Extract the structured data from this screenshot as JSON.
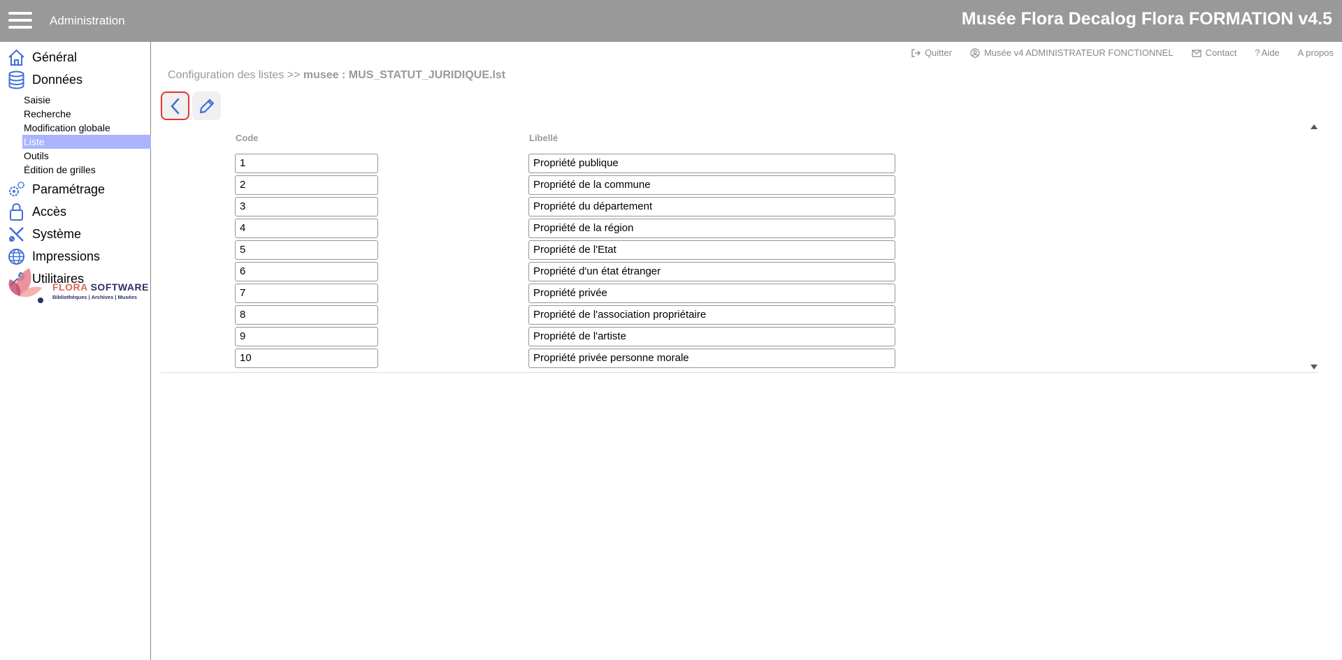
{
  "header": {
    "menu_icon": "hamburger-icon",
    "section": "Administration",
    "title": "Musée Flora Decalog Flora FORMATION v4.5"
  },
  "sidebar": {
    "items": [
      {
        "label": "Général",
        "icon": "home-icon"
      },
      {
        "label": "Données",
        "icon": "database-icon"
      },
      {
        "label": "Paramétrage",
        "icon": "gears-icon"
      },
      {
        "label": "Accès",
        "icon": "lock-icon"
      },
      {
        "label": "Système",
        "icon": "tools-icon"
      },
      {
        "label": "Impressions",
        "icon": "globe-icon"
      },
      {
        "label": "Utilitaires",
        "icon": "wrench-icon"
      }
    ],
    "sub_items": [
      "Saisie",
      "Recherche",
      "Modification globale",
      "Liste",
      "Outils",
      "Édition de grilles"
    ],
    "active_sub": "Liste",
    "logo": {
      "flora": "FLORA",
      "software": " SOFTWARE",
      "tagline": "Bibliothèques | Archives | Musées"
    }
  },
  "toplinks": {
    "quit": "Quitter",
    "user": "Musée v4 ADMINISTRATEUR FONCTIONNEL",
    "contact": "Contact",
    "help": "Aide",
    "about": "A propos"
  },
  "breadcrumb": {
    "prefix": "Configuration des listes >> ",
    "current": "musee : MUS_STATUT_JURIDIQUE.lst"
  },
  "table": {
    "headers": {
      "code": "Code",
      "label": "Libellé"
    },
    "rows": [
      {
        "code": "1",
        "label": "Propriété publique"
      },
      {
        "code": "2",
        "label": "Propriété de la commune"
      },
      {
        "code": "3",
        "label": "Propriété du département"
      },
      {
        "code": "4",
        "label": "Propriété de la région"
      },
      {
        "code": "5",
        "label": "Propriété de l'Etat"
      },
      {
        "code": "6",
        "label": "Propriété d'un état étranger"
      },
      {
        "code": "7",
        "label": "Propriété privée"
      },
      {
        "code": "8",
        "label": "Propriété de l'association propriétaire"
      },
      {
        "code": "9",
        "label": "Propriété de l'artiste"
      },
      {
        "code": "10",
        "label": "Propriété privée personne morale"
      }
    ]
  },
  "colors": {
    "topbar": "#999999",
    "accent": "#3b6fd9",
    "active_bg": "#aab4ff",
    "back_border": "#e0342f"
  }
}
